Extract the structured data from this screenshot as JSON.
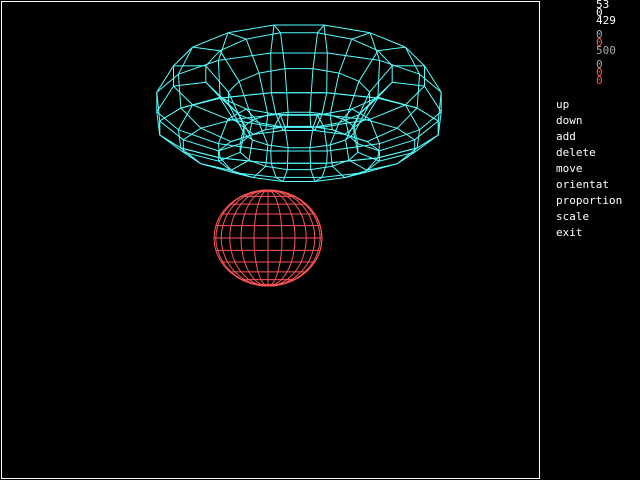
{
  "colors": {
    "background": "#000000",
    "border": "#ffffff",
    "torus_wire": "#55ffff",
    "sphere_wire": "#ff5555",
    "text": "#ffffff",
    "value_gray": "#aaaaaa",
    "value_red": "#ff5555"
  },
  "stats": [
    {
      "id": "stat-1",
      "value": "53",
      "color": "#ffffff"
    },
    {
      "id": "stat-2",
      "value": "0",
      "color": "#ffffff"
    },
    {
      "id": "stat-3",
      "value": "429",
      "color": "#ffffff"
    },
    {
      "id": "stat-4",
      "value": "0",
      "color": "#aaaaaa"
    },
    {
      "id": "stat-5",
      "value": "0",
      "color": "#ff5555"
    },
    {
      "id": "stat-6",
      "value": "500",
      "color": "#aaaaaa"
    },
    {
      "id": "stat-7",
      "value": "0",
      "color": "#aaaaaa"
    },
    {
      "id": "stat-8",
      "value": "0",
      "color": "#ff5555"
    },
    {
      "id": "stat-9",
      "value": "0",
      "color": "#ff5555"
    }
  ],
  "menu": [
    "up",
    "down",
    "add",
    "delete",
    "move",
    "orientat",
    "proportion",
    "scale",
    "exit"
  ],
  "objects": {
    "torus": {
      "icon": "torus-wireframe",
      "color": "#55ffff"
    },
    "sphere": {
      "icon": "sphere-wireframe",
      "color": "#ff5555"
    }
  }
}
